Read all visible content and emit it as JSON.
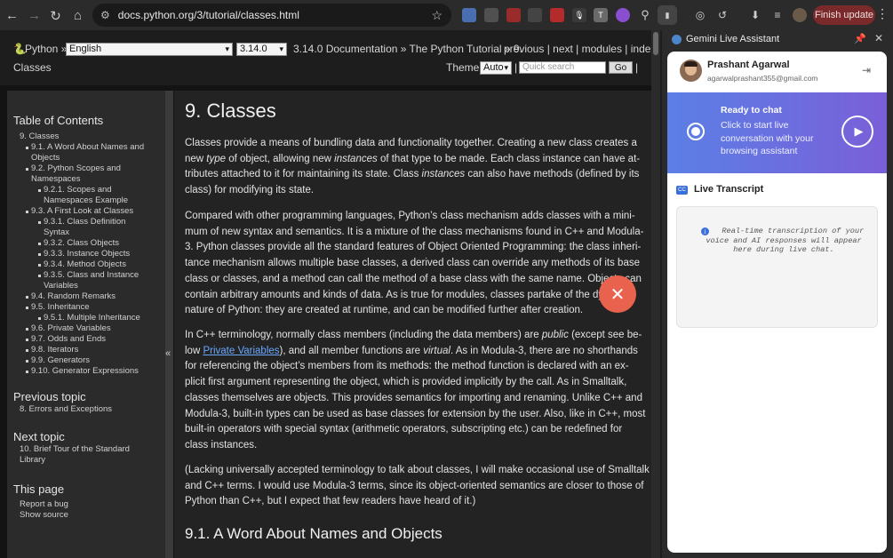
{
  "browser": {
    "url": "docs.python.org/3/tutorial/classes.html",
    "finish_update": "Finish update",
    "extensions": [
      "ext-a",
      "ext-b",
      "ext-c",
      "ext-d",
      "ext-e",
      "ext-f",
      "ext-g",
      "ext-h",
      "ext-i",
      "ext-j"
    ]
  },
  "related": {
    "python_label": "Python »",
    "language": "English",
    "version": "3.14.0",
    "crumbs": "3.14.0 Documentation » The Python Tutorial » 9.",
    "nav_links": "previous | next | modules | index",
    "second_line": "Classes",
    "theme_label": "Theme",
    "theme_value": "Auto",
    "search_placeholder": "Quick search",
    "go": "Go",
    "pipe": "|"
  },
  "sidebar": {
    "toc_heading": "Table of Contents",
    "toc": [
      {
        "level": 0,
        "text": "9. Classes"
      },
      {
        "level": 1,
        "text": "9.1. A Word About Names and Objects"
      },
      {
        "level": 1,
        "text": "9.2. Python Scopes and Namespaces"
      },
      {
        "level": 2,
        "text": "9.2.1. Scopes and Namespaces Example"
      },
      {
        "level": 1,
        "text": "9.3. A First Look at Classes"
      },
      {
        "level": 2,
        "text": "9.3.1. Class Definition Syntax"
      },
      {
        "level": 2,
        "text": "9.3.2. Class Objects"
      },
      {
        "level": 2,
        "text": "9.3.3. Instance Objects"
      },
      {
        "level": 2,
        "text": "9.3.4. Method Objects"
      },
      {
        "level": 2,
        "text": "9.3.5. Class and Instance Variables"
      },
      {
        "level": 1,
        "text": "9.4. Random Remarks"
      },
      {
        "level": 1,
        "text": "9.5. Inheritance"
      },
      {
        "level": 2,
        "text": "9.5.1. Multiple Inheritance"
      },
      {
        "level": 1,
        "text": "9.6. Private Variables"
      },
      {
        "level": 1,
        "text": "9.7. Odds and Ends"
      },
      {
        "level": 1,
        "text": "9.8. Iterators"
      },
      {
        "level": 1,
        "text": "9.9. Generators"
      },
      {
        "level": 1,
        "text": "9.10. Generator Expressions"
      }
    ],
    "prev_heading": "Previous topic",
    "prev_link": "8. Errors and Exceptions",
    "next_heading": "Next topic",
    "next_link": "10. Brief Tour of the Standard Library",
    "this_page_heading": "This page",
    "report_bug": "Report a bug",
    "show_source": "Show source",
    "collapse_glyph": "«"
  },
  "content": {
    "title": "9. Classes",
    "p1": [
      "Classes provide a means of bundling data and functionality together. Creating a new class creates a",
      "new type of object, allowing new instances of that type to be made. Each class instance can have at-",
      "tributes attached to it for maintaining its state. Class instances can also have methods (defined by its",
      "class) for modifying its state."
    ],
    "p2": [
      "Compared with other programming languages, Python’s class mechanism adds classes with a mini-",
      "mum of new syntax and semantics. It is a mixture of the class mechanisms found in C++ and Modula-",
      "3. Python classes provide all the standard features of Object Oriented Programming: the class inheri-",
      "tance mechanism allows multiple base classes, a derived class can override any methods of its base",
      "class or classes, and a method can call the method of a base class with the same name. Objects can",
      "contain arbitrary amounts and kinds of data. As is true for modules, classes partake of the dynamic",
      "nature of Python: they are created at runtime, and can be modified further after creation."
    ],
    "p3": [
      "In C++ terminology, normally class members (including the data members) are public (except see be-",
      "low Private Variables), and all member functions are virtual. As in Modula-3, there are no shorthands",
      "for referencing the object’s members from its methods: the method function is declared with an ex-",
      "plicit first argument representing the object, which is provided implicitly by the call. As in Smalltalk,",
      "classes themselves are objects. This provides semantics for importing and renaming. Unlike C++ and",
      "Modula-3, built-in types can be used as base classes for extension by the user. Also, like in C++, most",
      "built-in operators with special syntax (arithmetic operators, subscripting etc.) can be redefined for",
      "class instances."
    ],
    "p3_link": "Private Variables",
    "p4": [
      "(Lacking universally accepted terminology to talk about classes, I will make occasional use of Smalltalk",
      "and C++ terms. I would use Modula-3 terms, since its object-oriented semantics are closer to those of",
      "Python than C++, but I expect that few readers have heard of it.)"
    ],
    "h2": "9.1. A Word About Names and Objects"
  },
  "assistant": {
    "panel_title": "Gemini Live Assistant",
    "user_name": "Prashant Agarwal",
    "user_email": "agarwalprashant355@gmail.com",
    "banner_title": "Ready to chat",
    "banner_desc": "Click to start live conversation with your browsing assistant",
    "transcript_title": "Live Transcript",
    "transcript_hint": "Real-time transcription of your voice and AI responses will appear here during live chat."
  }
}
